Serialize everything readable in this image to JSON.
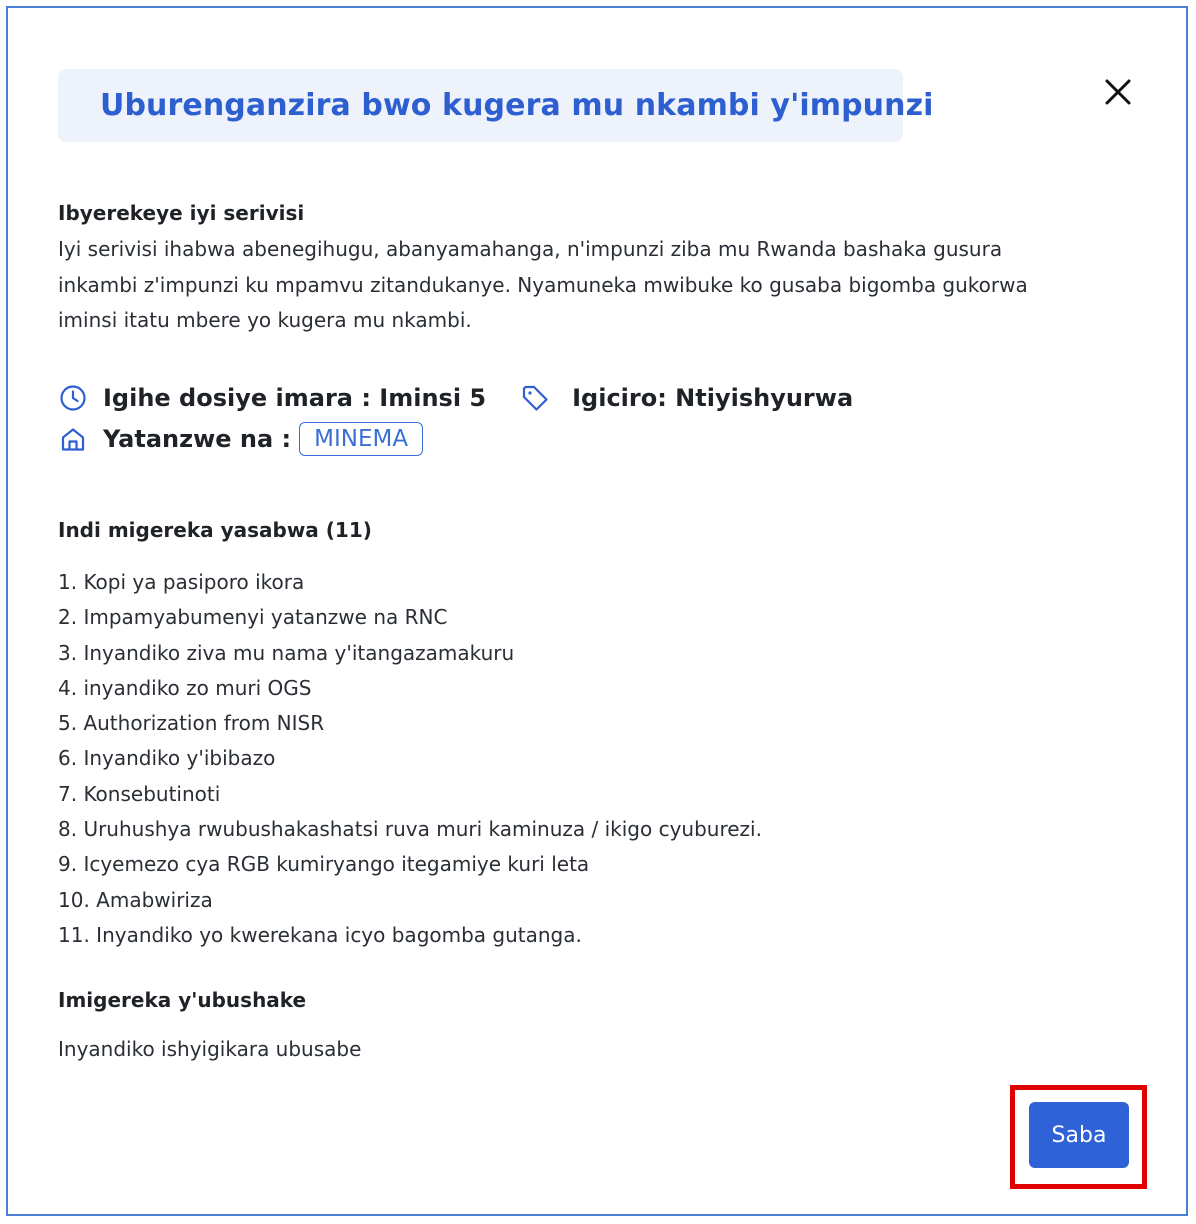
{
  "modal": {
    "title": "Uburenganzira bwo kugera mu nkambi y'impunzi",
    "close_icon": "close-icon"
  },
  "about": {
    "heading": "Ibyerekeye iyi serivisi",
    "lines": [
      "Iyi serivisi ihabwa abenegihugu, abanyamahanga, n'impunzi ziba mu Rwanda bashaka gusura",
      "inkambi z'impunzi ku mpamvu zitandukanye. Nyamuneka mwibuke ko gusaba bigomba gukorwa",
      "iminsi itatu mbere yo kugera mu nkambi."
    ]
  },
  "meta": {
    "processing_time": "Igihe dosiye imara : Iminsi 5",
    "price": "Igiciro: Ntiyishyurwa",
    "provider_label": "Yatanzwe na :",
    "provider_value": "MINEMA",
    "icons": [
      "clock-icon",
      "tag-icon",
      "home-icon"
    ],
    "accent_color": "#2d5fd0"
  },
  "required_documents": {
    "heading": "Indi migereka yasabwa (11)",
    "items": [
      "1. Kopi ya pasiporo ikora",
      "2. Impamyabumenyi yatanzwe na RNC",
      "3. Inyandiko ziva mu nama y'itangazamakuru",
      "4. inyandiko zo muri OGS",
      "5. Authorization from NISR",
      "6. Inyandiko y'ibibazo",
      "7. Konsebutinoti",
      "8. Uruhushya rwubushakashatsi ruva muri kaminuza / ikigo cyuburezi.",
      "9. Icyemezo cya RGB kumiryango itegamiye kuri leta",
      "10. Amabwiriza",
      "11. Inyandiko yo kwerekana icyo bagomba gutanga."
    ]
  },
  "optional_documents": {
    "heading": "Imigereka y'ubushake",
    "text": "Inyandiko ishyigikara ubusabe"
  },
  "actions": {
    "submit_label": "Saba",
    "button_color": "#2f62d6",
    "highlight_color": "#e00000"
  }
}
